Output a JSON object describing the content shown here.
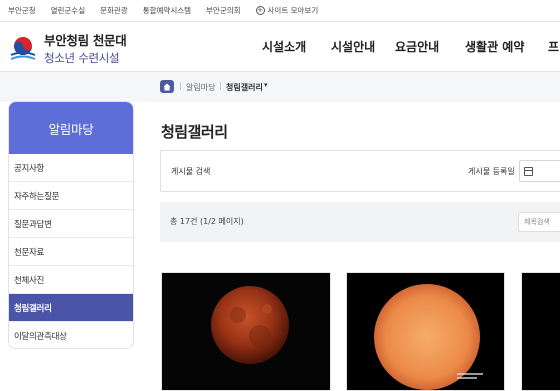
{
  "topbar": {
    "links": [
      "부안군청",
      "열린군수실",
      "문화관광",
      "통합예약시스템",
      "부안군의회"
    ],
    "more_label": "사이트 모아보기",
    "more_icon": "plus-circle-icon"
  },
  "header": {
    "logo_line1": "부안청림 천문대",
    "logo_line2": "청소년 수련시설",
    "logo_icon": "taegeuk-logo",
    "nav": [
      "시설소개",
      "시설안내",
      "요금안내",
      "생활관 예약",
      "프"
    ]
  },
  "breadcrumb": {
    "home_icon": "home-icon",
    "items": [
      "알림마당",
      "청림갤러리"
    ],
    "dropdown_icon": "caret-down-icon"
  },
  "sidebar": {
    "title": "알림마당",
    "items": [
      {
        "label": "공지사항"
      },
      {
        "label": "자주하는질문"
      },
      {
        "label": "질문과답변"
      },
      {
        "label": "천문자료"
      },
      {
        "label": "천체사진"
      },
      {
        "label": "청림갤러리",
        "active": true
      },
      {
        "label": "이달의관측대상"
      }
    ],
    "active_color": "#4a55a8",
    "head_color": "#5d6ed8"
  },
  "main": {
    "title": "청림갤러리",
    "search": {
      "label": "게시물 검색",
      "date_label": "게시물 등록일",
      "calendar_icon": "calendar-icon"
    },
    "count_text": "총 17건 (1/2 페이지)",
    "sort_placeholder": "제목검색"
  },
  "gallery": [
    {
      "name": "lunar-eclipse-photo"
    },
    {
      "name": "sun-photo"
    },
    {
      "name": "third-photo"
    }
  ]
}
